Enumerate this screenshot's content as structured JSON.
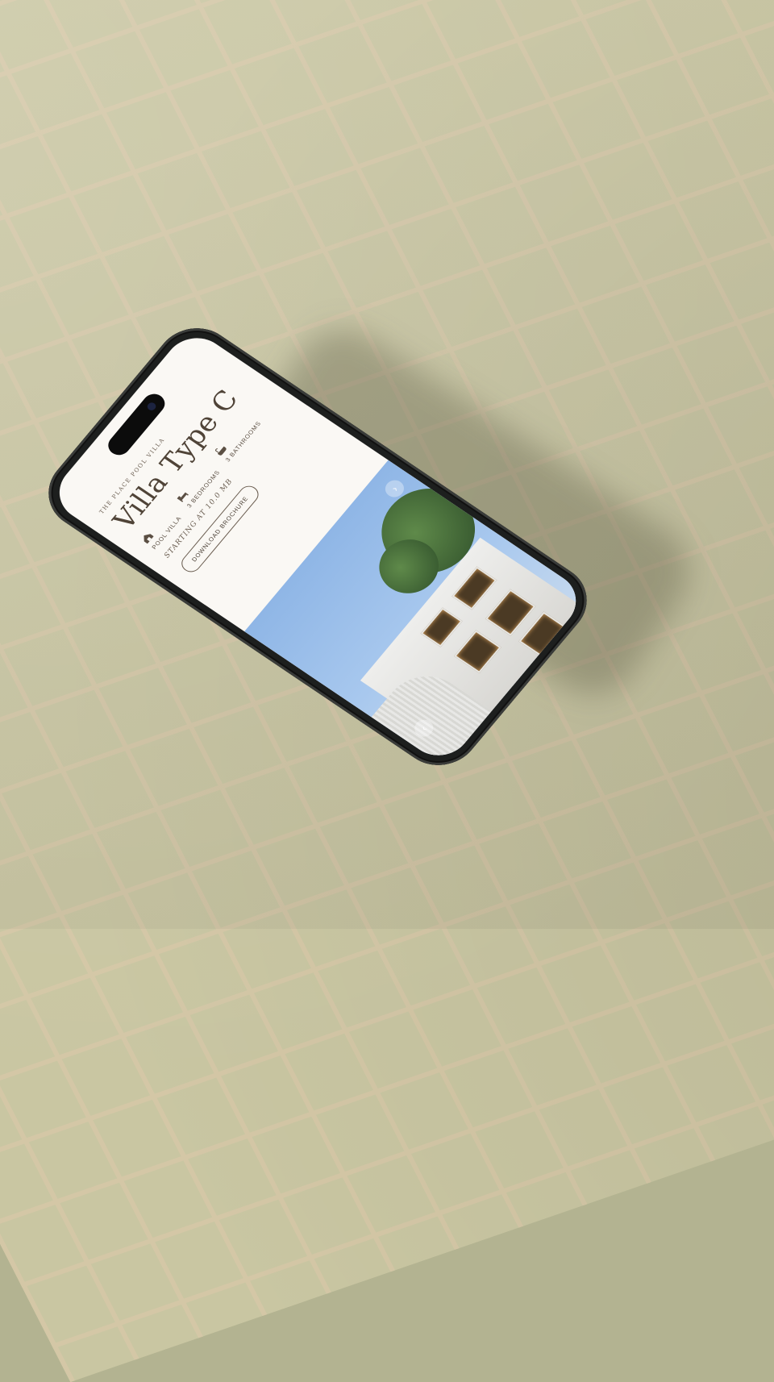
{
  "app": {
    "brand": "THE PLACE POOL VILLA",
    "title": "Villa Type C",
    "features": [
      {
        "icon": "house-icon",
        "label": "POOL VILLA"
      },
      {
        "icon": "bed-icon",
        "label": "3 BEDROOMS"
      },
      {
        "icon": "bath-icon",
        "label": "3 BATHROOMS"
      }
    ],
    "price": "STARTING AT 10.0 MB",
    "download_label": "DOWNLOAD BROCHURE",
    "gallery": {
      "prev_icon": "chevron-left-icon",
      "next_icon": "chevron-right-icon",
      "prev_glyph": "‹",
      "next_glyph": "›"
    }
  },
  "colors": {
    "background_tiles": "#c9c6a2",
    "grout": "#d4c7a6",
    "phone_frame": "#1d1f1e",
    "screen_bg": "#faf8f4",
    "text": "#4f4337",
    "sky": "#8fb6e6"
  }
}
